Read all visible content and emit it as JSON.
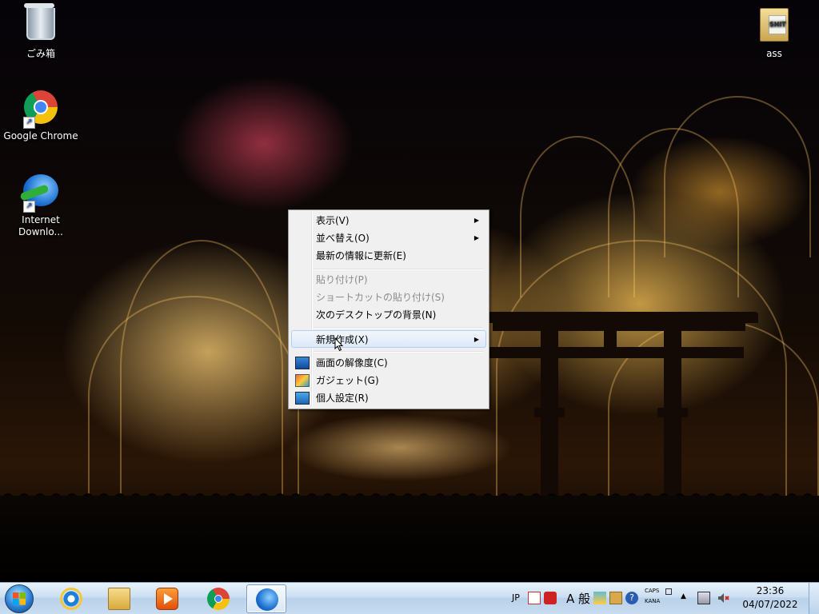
{
  "desktop": {
    "icons": [
      {
        "label": "ごみ箱"
      },
      {
        "label": "Google Chrome"
      },
      {
        "label": "Internet Downlo..."
      },
      {
        "label": "ass"
      }
    ]
  },
  "context_menu": {
    "items": [
      {
        "label": "表示(V)",
        "submenu": true,
        "enabled": true
      },
      {
        "label": "並べ替え(O)",
        "submenu": true,
        "enabled": true
      },
      {
        "label": "最新の情報に更新(E)",
        "submenu": false,
        "enabled": true
      },
      {
        "label": "貼り付け(P)",
        "submenu": false,
        "enabled": false
      },
      {
        "label": "ショートカットの貼り付け(S)",
        "submenu": false,
        "enabled": false
      },
      {
        "label": "次のデスクトップの背景(N)",
        "submenu": false,
        "enabled": true
      },
      {
        "label": "新規作成(X)",
        "submenu": true,
        "enabled": true,
        "highlighted": true
      },
      {
        "label": "画面の解像度(C)",
        "submenu": false,
        "enabled": true,
        "icon": "screen-resolution-icon"
      },
      {
        "label": "ガジェット(G)",
        "submenu": false,
        "enabled": true,
        "icon": "gadget-icon"
      },
      {
        "label": "個人設定(R)",
        "submenu": false,
        "enabled": true,
        "icon": "personalize-icon"
      }
    ]
  },
  "taskbar": {
    "pinned": [
      {
        "name": "Internet Explorer",
        "icon": "ie-icon"
      },
      {
        "name": "Windows Explorer",
        "icon": "explorer-icon"
      },
      {
        "name": "Windows Media Player",
        "icon": "media-player-icon"
      },
      {
        "name": "Google Chrome",
        "icon": "chrome-icon"
      },
      {
        "name": "Internet Download Manager",
        "icon": "idm-icon",
        "active": true
      }
    ],
    "tray": {
      "language": "JP",
      "ime_mode": "A 般",
      "caps": "CAPS",
      "kana": "KANA",
      "time": "23:36",
      "date": "04/07/2022"
    }
  },
  "colors": {
    "taskbar_top": "#e9f2fb",
    "menu_bg": "#f0f0f0",
    "menu_highlight_border": "#aecff7",
    "disabled_text": "#8b8b8b"
  }
}
